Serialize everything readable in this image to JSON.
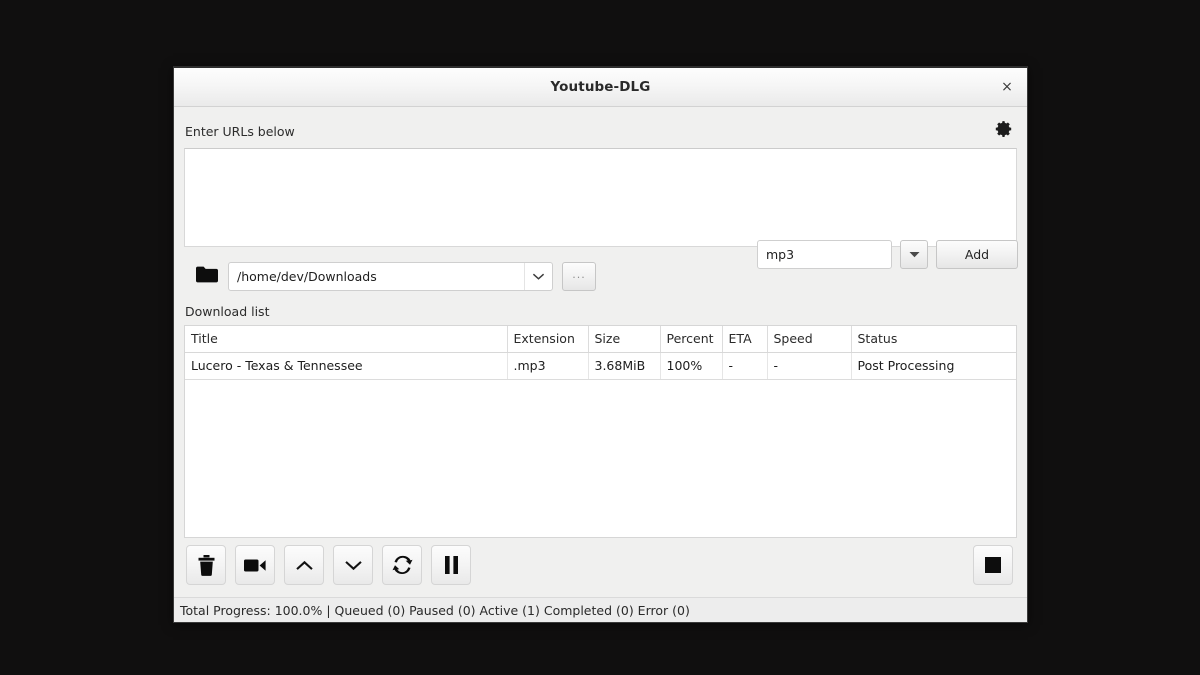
{
  "window": {
    "title": "Youtube-DLG",
    "close_label": "×",
    "close_icon": "close-icon"
  },
  "urls": {
    "label": "Enter URLs below",
    "value": "",
    "placeholder": "",
    "settings_icon": "gear-icon"
  },
  "path": {
    "folder_icon": "folder-icon",
    "value": "/home/dev/Downloads",
    "dropdown_icon": "chevron-down-icon",
    "browse_label": "..."
  },
  "format": {
    "value": "mp3",
    "dropdown_icon": "triangle-down-icon",
    "add_label": "Add"
  },
  "download_list": {
    "label": "Download list",
    "columns": [
      "Title",
      "Extension",
      "Size",
      "Percent",
      "ETA",
      "Speed",
      "Status"
    ],
    "rows": [
      {
        "title": "Lucero - Texas & Tennessee",
        "extension": ".mp3",
        "size": "3.68MiB",
        "percent": "100%",
        "eta": "-",
        "speed": "-",
        "status": "Post Processing"
      }
    ]
  },
  "toolbar": {
    "buttons": [
      {
        "name": "delete-button",
        "icon": "trash-icon"
      },
      {
        "name": "video-button",
        "icon": "camcorder-icon"
      },
      {
        "name": "move-up-button",
        "icon": "chevron-up-icon"
      },
      {
        "name": "move-down-button",
        "icon": "chevron-down-icon"
      },
      {
        "name": "reload-button",
        "icon": "refresh-icon"
      },
      {
        "name": "pause-button",
        "icon": "pause-icon"
      }
    ],
    "stop": {
      "name": "stop-button",
      "icon": "stop-square-icon"
    }
  },
  "statusbar": {
    "text": "Total Progress: 100.0% | Queued (0) Paused (0) Active (1) Completed (0) Error (0)"
  },
  "colors": {
    "desktop_background": "#100f0f",
    "window_background": "#f0f0ef",
    "titlebar_top": "#fdfdfd",
    "titlebar_bottom": "#eaeaea",
    "field_background": "#ffffff",
    "text": "#1d1d1d"
  }
}
